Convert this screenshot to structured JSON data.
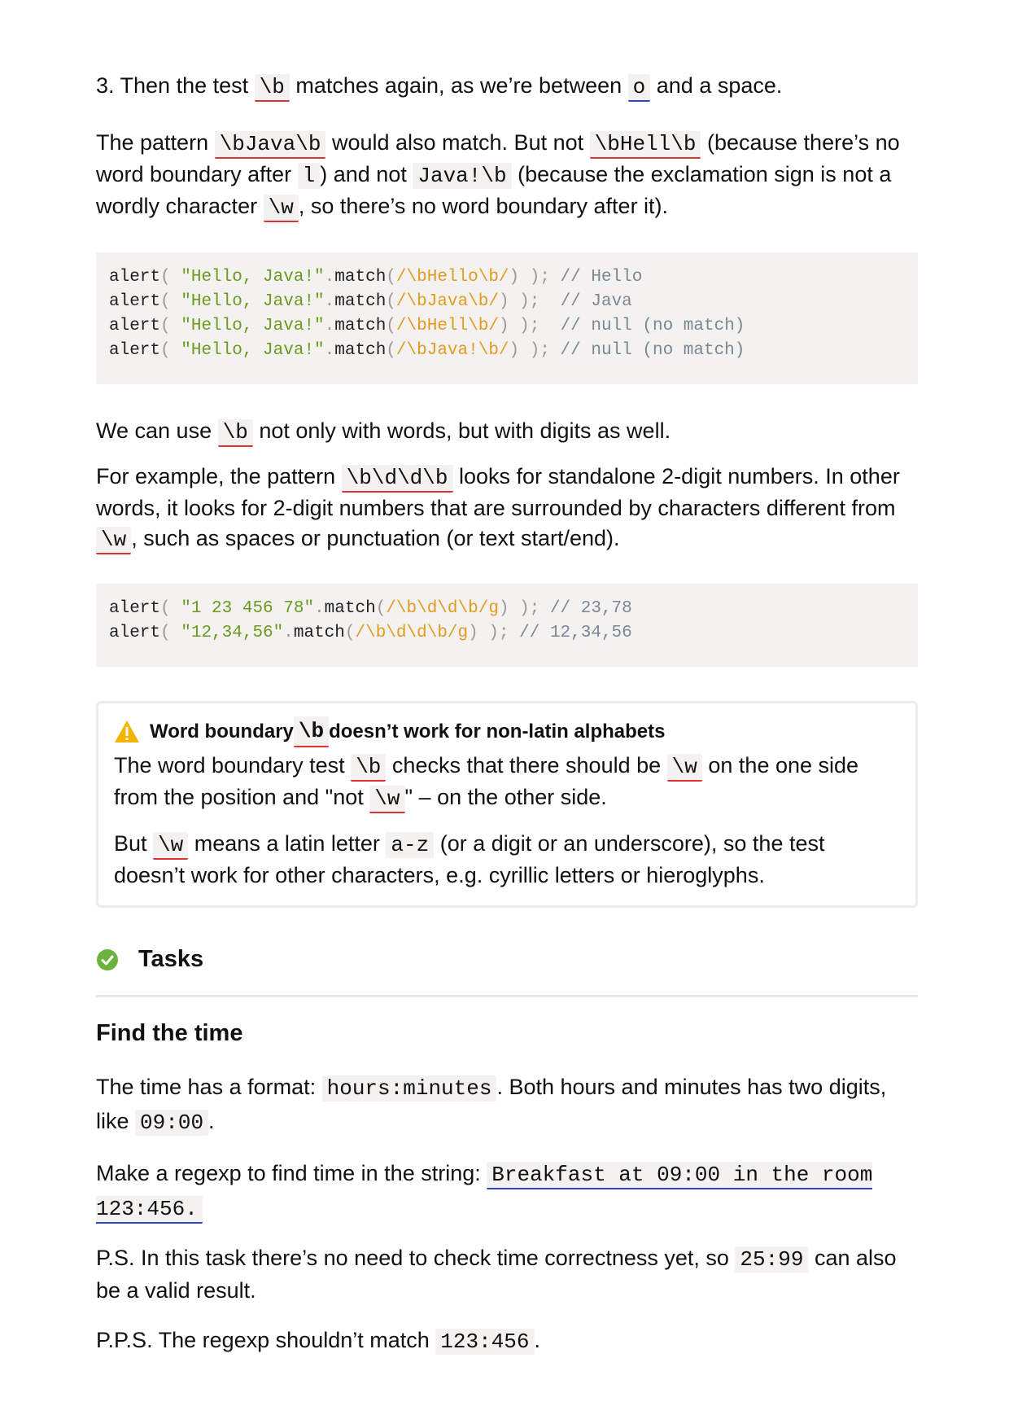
{
  "item3": {
    "num": "3. Then the test",
    "code1": "\\b",
    "mid": "matches again, as we’re between",
    "code2": "o",
    "end": "and a space."
  },
  "para_pattern": {
    "a": "The pattern",
    "c1": "\\bJava\\b",
    "b": "would also match. But not",
    "c2": "\\bHell\\b",
    "c": "(because there’s no word boundary after",
    "c3": "l",
    "d": ") and not",
    "c4": "Java!\\b",
    "e": "(because the exclamation sign is not a wordly character",
    "c5": "\\w",
    "f": ", so there’s no word boundary after it)."
  },
  "code_block_1": [
    {
      "fn": "alert",
      "p1": "( ",
      "str": "\"Hello, Java!\"",
      "dot": ".",
      "m": "match",
      "p2": "(",
      "re": "/\\bHello\\b/",
      "p3": ") ); ",
      "com": "// Hello"
    },
    {
      "fn": "alert",
      "p1": "( ",
      "str": "\"Hello, Java!\"",
      "dot": ".",
      "m": "match",
      "p2": "(",
      "re": "/\\bJava\\b/",
      "p3": ") );  ",
      "com": "// Java"
    },
    {
      "fn": "alert",
      "p1": "( ",
      "str": "\"Hello, Java!\"",
      "dot": ".",
      "m": "match",
      "p2": "(",
      "re": "/\\bHell\\b/",
      "p3": ") );  ",
      "com": "// null (no match)"
    },
    {
      "fn": "alert",
      "p1": "( ",
      "str": "\"Hello, Java!\"",
      "dot": ".",
      "m": "match",
      "p2": "(",
      "re": "/\\bJava!\\b/",
      "p3": ") ); ",
      "com": "// null (no match)"
    }
  ],
  "para_digits": {
    "a": "We can use",
    "c1": "\\b",
    "b": "not only with words, but with digits as well."
  },
  "para_example": {
    "a": "For example, the pattern",
    "c1": "\\b\\d\\d\\b",
    "b": "looks for standalone 2-digit numbers. In other words, it looks for 2-digit numbers that are surrounded by characters different from",
    "c2": "\\w",
    "c": ", such as spaces or punctuation (or text start/end)."
  },
  "code_block_2": [
    {
      "fn": "alert",
      "p1": "( ",
      "str": "\"1 23 456 78\"",
      "dot": ".",
      "m": "match",
      "p2": "(",
      "re": "/\\b\\d\\d\\b/g",
      "p3": ") ); ",
      "com": "// 23,78"
    },
    {
      "fn": "alert",
      "p1": "( ",
      "str": "\"12,34,56\"",
      "dot": ".",
      "m": "match",
      "p2": "(",
      "re": "/\\b\\d\\d\\b/g",
      "p3": ") ); ",
      "com": "// 12,34,56"
    }
  ],
  "warning": {
    "title_a": "Word boundary",
    "title_code": "\\b",
    "title_b": "doesn’t work for non-latin alphabets",
    "p1_a": "The word boundary test",
    "p1_c1": "\\b",
    "p1_b": "checks that there should be",
    "p1_c2": "\\w",
    "p1_c": "on the one side from the position and \"not",
    "p1_c3": "\\w",
    "p1_d": "\" – on the other side.",
    "p2_a": "But",
    "p2_c1": "\\w",
    "p2_b": "means a latin letter",
    "p2_c2": "a-z",
    "p2_c": "(or a digit or an underscore), so the test doesn’t work for other characters, e.g. cyrillic letters or hieroglyphs."
  },
  "tasks": {
    "heading": "Tasks",
    "task_title": "Find the time",
    "t1_a": "The time has a format:",
    "t1_c1": "hours:minutes",
    "t1_b": ". Both hours and minutes has two digits, like",
    "t1_c2": "09:00",
    "t1_c": ".",
    "t2_a": "Make a regexp to find time in the string:",
    "t2_c1": "Breakfast at 09:00 in the room 123:456.",
    "t3_a": "P.S. In this task there’s no need to check time correctness yet, so",
    "t3_c1": "25:99",
    "t3_b": "can also be a valid result.",
    "t4_a": "P.P.S. The regexp shouldn’t match",
    "t4_c1": "123:456",
    "t4_b": "."
  },
  "colors": {
    "string": "#6a9a1f",
    "regexp": "#e09b20",
    "comment": "#7b8794",
    "code_bg": "#f4f2f0",
    "warn_icon": "#f5b400",
    "task_icon": "#6cb33e"
  },
  "icons": {
    "warning": "warning-triangle-icon",
    "tasks": "check-circle-icon"
  }
}
